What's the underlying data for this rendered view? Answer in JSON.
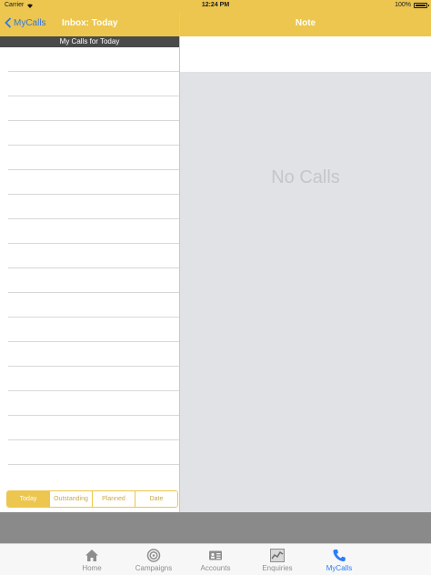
{
  "status_bar": {
    "carrier": "Carrier",
    "time": "12:24 PM",
    "battery": "100%"
  },
  "left_nav": {
    "back_label": "MyCalls",
    "title": "Inbox: Today"
  },
  "right_nav": {
    "title": "Note"
  },
  "list": {
    "section_header": "My Calls for Today"
  },
  "segments": [
    {
      "label": "Today",
      "active": true
    },
    {
      "label": "Outstanding",
      "active": false
    },
    {
      "label": "Planned",
      "active": false
    },
    {
      "label": "Date",
      "active": false
    }
  ],
  "detail": {
    "empty_message": "No Calls"
  },
  "tabs": [
    {
      "label": "Home",
      "icon": "house-icon"
    },
    {
      "label": "Campaigns",
      "icon": "target-icon"
    },
    {
      "label": "Accounts",
      "icon": "id-card-icon"
    },
    {
      "label": "Enquiries",
      "icon": "chart-icon"
    },
    {
      "label": "MyCalls",
      "icon": "phone-icon",
      "active": true
    }
  ],
  "colors": {
    "accent": "#ecc64e",
    "link": "#3478e0",
    "active_tab": "#2e7cf6"
  }
}
